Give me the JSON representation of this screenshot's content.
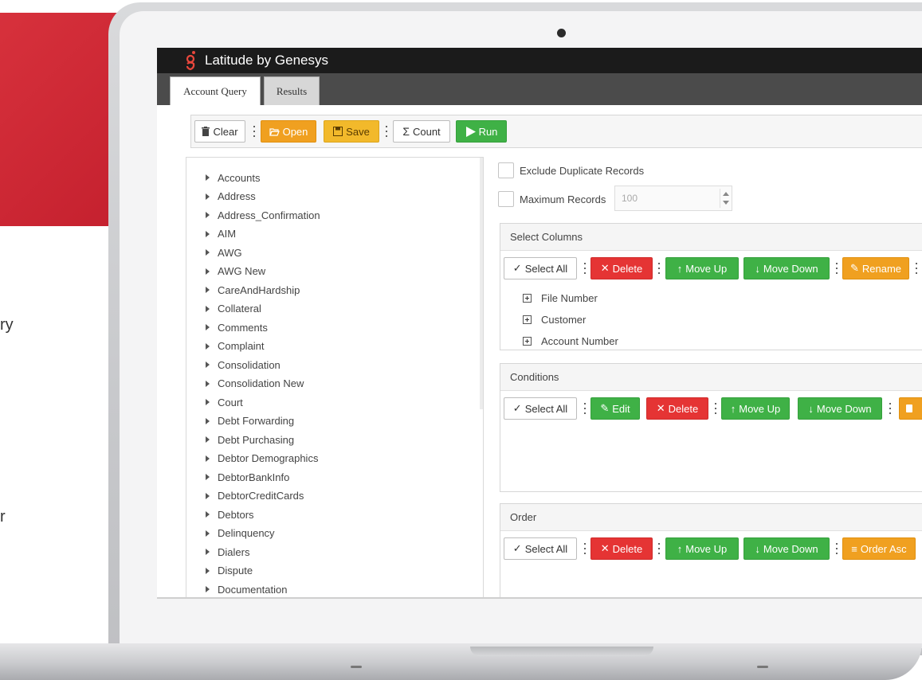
{
  "side_fragments": [
    "ry",
    "r"
  ],
  "app": {
    "title": "Latitude by Genesys",
    "logo_icon": "genesys-logo-icon"
  },
  "tabs": [
    {
      "label": "Account Query",
      "active": true
    },
    {
      "label": "Results",
      "active": false
    }
  ],
  "toolbar": {
    "clear": "Clear",
    "open": "Open",
    "save": "Save",
    "count": "Count",
    "run": "Run"
  },
  "tree": {
    "items": [
      "Accounts",
      "Address",
      "Address_Confirmation",
      "AIM",
      "AWG",
      "AWG New",
      "CareAndHardship",
      "Collateral",
      "Comments",
      "Complaint",
      "Consolidation",
      "Consolidation New",
      "Court",
      "Debt Forwarding",
      "Debt Purchasing",
      "Debtor Demographics",
      "DebtorBankInfo",
      "DebtorCreditCards",
      "Debtors",
      "Delinquency",
      "Dialers",
      "Dispute",
      "Documentation"
    ]
  },
  "options": {
    "exclude_duplicates": "Exclude Duplicate Records",
    "max_records_label": "Maximum Records",
    "max_records_placeholder": "100"
  },
  "select_columns": {
    "title": "Select Columns",
    "buttons": {
      "select_all": "Select All",
      "delete": "Delete",
      "move_up": "Move Up",
      "move_down": "Move Down",
      "rename": "Rename"
    },
    "items": [
      "File Number",
      "Customer",
      "Account Number"
    ]
  },
  "conditions": {
    "title": "Conditions",
    "buttons": {
      "select_all": "Select All",
      "edit": "Edit",
      "delete": "Delete",
      "move_up": "Move Up",
      "move_down": "Move Down"
    }
  },
  "order": {
    "title": "Order",
    "buttons": {
      "select_all": "Select All",
      "delete": "Delete",
      "move_up": "Move Up",
      "move_down": "Move Down",
      "order_asc": "Order Asc"
    }
  },
  "colors": {
    "brand_red": "#d7313c",
    "green": "#3fb146",
    "orange": "#f0a020",
    "red": "#e53434",
    "titlebar": "#1b1b1b"
  }
}
